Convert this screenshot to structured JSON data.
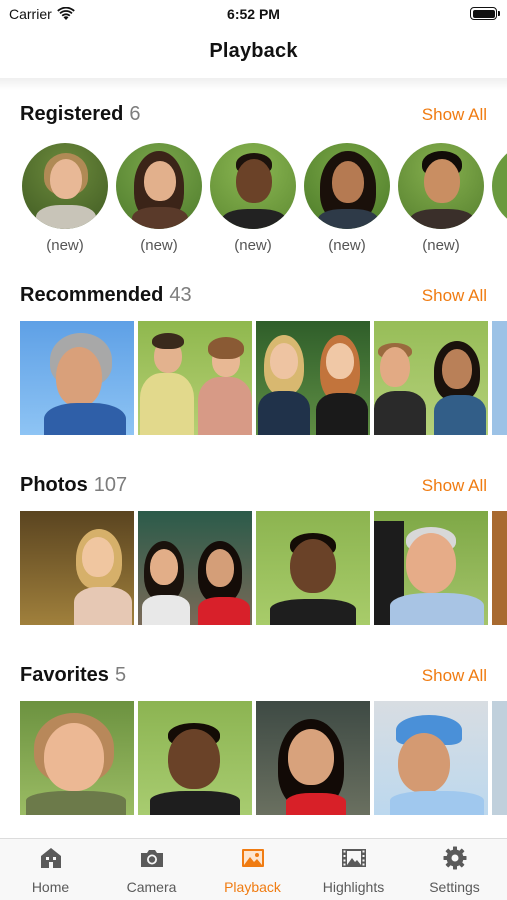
{
  "status_bar": {
    "carrier": "Carrier",
    "time": "6:52 PM"
  },
  "nav": {
    "title": "Playback"
  },
  "sections": {
    "registered": {
      "title": "Registered",
      "count": "6",
      "show_all": "Show All",
      "items": [
        {
          "label": "(new)"
        },
        {
          "label": "(new)"
        },
        {
          "label": "(new)"
        },
        {
          "label": "(new)"
        },
        {
          "label": "(new)"
        }
      ]
    },
    "recommended": {
      "title": "Recommended",
      "count": "43",
      "show_all": "Show All"
    },
    "photos": {
      "title": "Photos",
      "count": "107",
      "show_all": "Show All"
    },
    "favorites": {
      "title": "Favorites",
      "count": "5",
      "show_all": "Show All"
    }
  },
  "tabs": [
    {
      "label": "Home",
      "icon": "home-icon"
    },
    {
      "label": "Camera",
      "icon": "camera-icon"
    },
    {
      "label": "Playback",
      "icon": "photo-icon",
      "active": true
    },
    {
      "label": "Highlights",
      "icon": "film-icon"
    },
    {
      "label": "Settings",
      "icon": "gear-icon"
    }
  ],
  "colors": {
    "accent": "#f07c12",
    "count_gray": "#7d7d7d",
    "tab_inactive": "#5a5a5a"
  }
}
